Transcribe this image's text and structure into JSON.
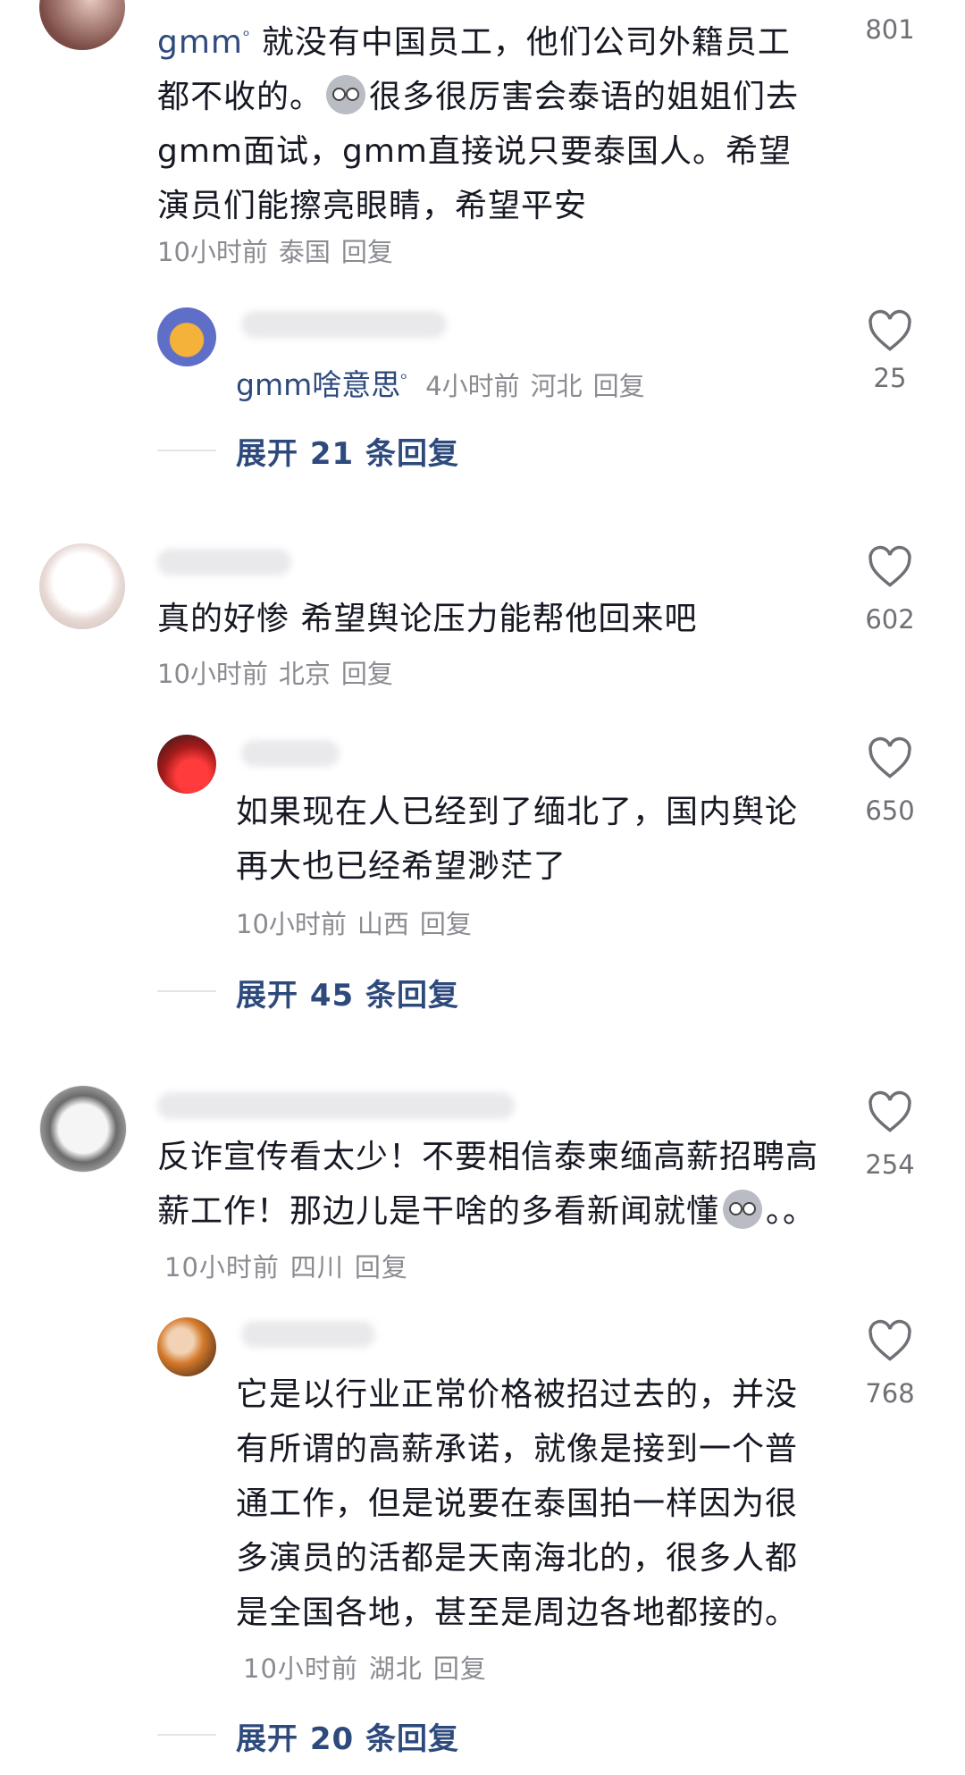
{
  "comments": [
    {
      "mention": "gmm",
      "text": " 就没有中国员工，他们公司外籍员工都不收的。",
      "text_after_emoji": "很多很厉害会泰语的姐姐们去gmm面试，gmm直接说只要泰国人。希望演员们能擦亮眼睛，希望平安",
      "time": "10小时前",
      "location": "泰国",
      "reply": "回复",
      "likes": "801",
      "reply_item": {
        "text_mention": "gmm啥意思",
        "time": "4小时前",
        "location": "河北",
        "reply": "回复",
        "likes": "25"
      },
      "expand": "展开 21 条回复"
    },
    {
      "text": "真的好惨 希望舆论压力能帮他回来吧",
      "time": "10小时前",
      "location": "北京",
      "reply": "回复",
      "likes": "602",
      "reply_item": {
        "text": "如果现在人已经到了缅北了，国内舆论再大也已经希望渺茫了",
        "time": "10小时前",
        "location": "山西",
        "reply": "回复",
        "likes": "650"
      },
      "expand": "展开 45 条回复"
    },
    {
      "text": "反诈宣传看太少！不要相信泰柬缅高薪招聘高薪工作！那边儿是干啥的多看新闻就懂",
      "text_tail": "。。",
      "time": "10小时前",
      "location": "四川",
      "reply": "回复",
      "likes": "254",
      "reply_item": {
        "text": "它是以行业正常价格被招过去的，并没有所谓的高薪承诺，就像是接到一个普通工作，但是说要在泰国拍一样因为很多演员的活都是天南海北的，很多人都是全国各地，甚至是周边各地都接的。",
        "time": "10小时前",
        "location": "湖北",
        "reply": "回复",
        "likes": "768"
      },
      "expand": "展开 20 条回复"
    }
  ],
  "icons": {
    "like": "heart-outline-icon",
    "search_hint": "search-hint-icon",
    "emoji": "crying-face-emoji"
  },
  "colors": {
    "link": "#2e4a7d",
    "meta": "#8a8b91",
    "text": "#161823"
  }
}
